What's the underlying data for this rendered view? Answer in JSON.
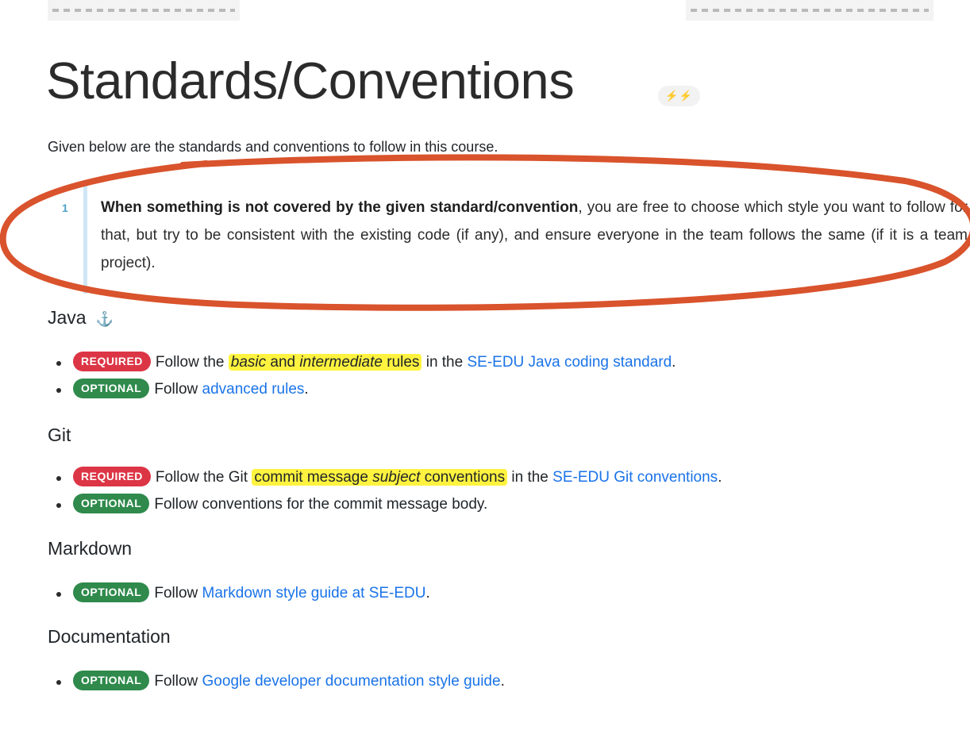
{
  "page": {
    "title": "Standards/Conventions",
    "title_badge": "⚡⚡",
    "intro": "Given below are the standards and conventions to follow in this course."
  },
  "note": {
    "number": "1",
    "bold_text": "When something is not covered by the given standard/convention",
    "rest_text": ", you are free to choose which style you want to follow for that, but try to be consistent with the existing code (if any), and ensure everyone in the team follows the same (if it is a team project)."
  },
  "annotation": {
    "circle_color": "#d9532c"
  },
  "colors": {
    "required": "#dc3545",
    "optional": "#2f8a4c",
    "link": "#1a73e8",
    "highlight": "#fff33f"
  },
  "sections": {
    "java": {
      "heading": "Java",
      "anchor_icon": "anchor-icon",
      "item1": {
        "badge": "REQUIRED",
        "pre": "Follow the ",
        "hl_italic1": "basic",
        "hl_mid": " and ",
        "hl_italic2": "intermediate",
        "hl_end": " rules",
        "post": " in the ",
        "link": "SE-EDU Java coding standard",
        "end": "."
      },
      "item2": {
        "badge": "OPTIONAL",
        "pre": "Follow ",
        "link": "advanced rules",
        "end": "."
      }
    },
    "git": {
      "heading": "Git",
      "item1": {
        "badge": "REQUIRED",
        "pre": "Follow the Git ",
        "hl_start": "commit message ",
        "hl_italic": "subject",
        "hl_end": " conventions",
        "post": " in the ",
        "link": "SE-EDU Git conventions",
        "end": "."
      },
      "item2": {
        "badge": "OPTIONAL",
        "text": "Follow conventions for the commit message body."
      }
    },
    "markdown": {
      "heading": "Markdown",
      "item1": {
        "badge": "OPTIONAL",
        "pre": "Follow ",
        "link": "Markdown style guide at SE-EDU",
        "end": "."
      }
    },
    "documentation": {
      "heading": "Documentation",
      "item1": {
        "badge": "OPTIONAL",
        "pre": "Follow ",
        "link": "Google developer documentation style guide",
        "end": "."
      }
    }
  }
}
